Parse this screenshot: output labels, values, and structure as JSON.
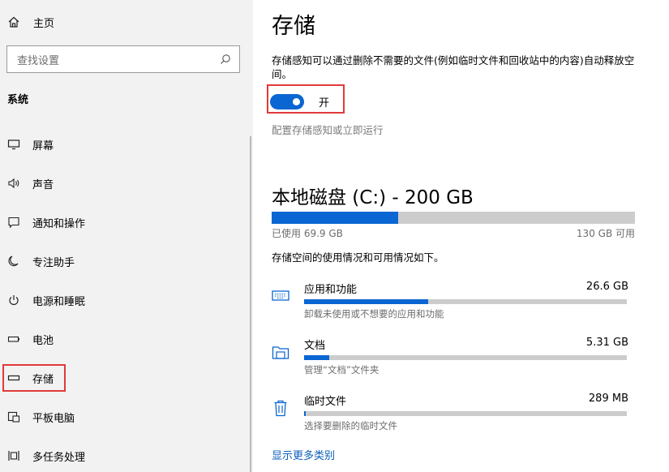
{
  "sidebar": {
    "home_label": "主页",
    "search_placeholder": "查找设置",
    "section_title": "系统",
    "items": [
      {
        "label": "屏幕",
        "icon": "monitor-icon"
      },
      {
        "label": "声音",
        "icon": "speaker-icon"
      },
      {
        "label": "通知和操作",
        "icon": "notification-icon"
      },
      {
        "label": "专注助手",
        "icon": "moon-icon"
      },
      {
        "label": "电源和睡眠",
        "icon": "power-icon"
      },
      {
        "label": "电池",
        "icon": "battery-icon"
      },
      {
        "label": "存储",
        "icon": "storage-icon",
        "active": true
      },
      {
        "label": "平板电脑",
        "icon": "tablet-icon"
      },
      {
        "label": "多任务处理",
        "icon": "multitask-icon"
      }
    ]
  },
  "main": {
    "title": "存储",
    "description": "存储感知可以通过删除不需要的文件(例如临时文件和回收站中的内容)自动释放空间。",
    "toggle": {
      "state": "on",
      "label": "开"
    },
    "config_link": "配置存储感知或立即运行",
    "disk": {
      "title": "本地磁盘 (C:) - 200 GB",
      "used_label": "已使用 69.9 GB",
      "available_label": "130 GB 可用",
      "used_fraction": 0.349
    },
    "usage_info": "存储空间的使用情况和可用情况如下。",
    "categories": [
      {
        "name": "应用和功能",
        "size": "26.6 GB",
        "desc": "卸载未使用或不想要的应用和功能",
        "icon": "keyboard-icon",
        "fraction": 0.385
      },
      {
        "name": "文档",
        "size": "5.31 GB",
        "desc": "管理“文档”文件夹",
        "icon": "folder-icon",
        "fraction": 0.077
      },
      {
        "name": "临时文件",
        "size": "289 MB",
        "desc": "选择要删除的临时文件",
        "icon": "trash-icon",
        "fraction": 0.005
      }
    ],
    "more_link": "显示更多类别"
  },
  "colors": {
    "accent": "#0a66d2",
    "highlight": "#e03a3a",
    "bar_bg": "#cccccc"
  }
}
